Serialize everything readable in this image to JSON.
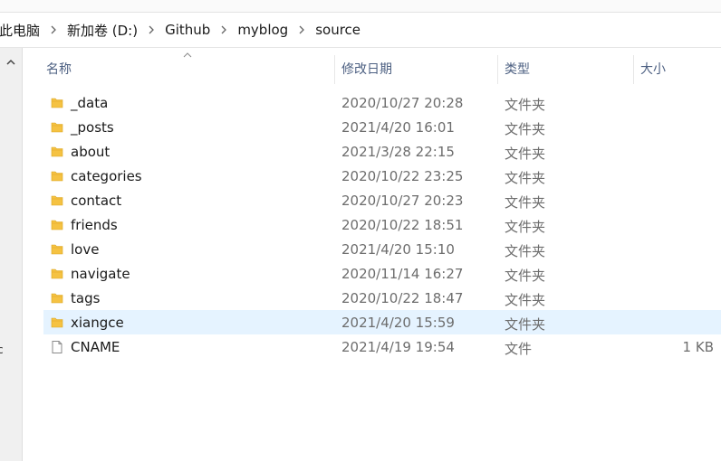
{
  "breadcrumb": {
    "items": [
      "此电脑",
      "新加卷 (D:)",
      "Github",
      "myblog",
      "source"
    ]
  },
  "columns": {
    "name": "名称",
    "date": "修改日期",
    "type": "类型",
    "size": "大小"
  },
  "nav_pane": {
    "fragment": "c"
  },
  "files": [
    {
      "name": "_data",
      "date": "2020/10/27 20:28",
      "type": "文件夹",
      "size": "",
      "icon": "folder-icon"
    },
    {
      "name": "_posts",
      "date": "2021/4/20 16:01",
      "type": "文件夹",
      "size": "",
      "icon": "folder-icon"
    },
    {
      "name": "about",
      "date": "2021/3/28 22:15",
      "type": "文件夹",
      "size": "",
      "icon": "folder-icon"
    },
    {
      "name": "categories",
      "date": "2020/10/22 23:25",
      "type": "文件夹",
      "size": "",
      "icon": "folder-icon"
    },
    {
      "name": "contact",
      "date": "2020/10/27 20:23",
      "type": "文件夹",
      "size": "",
      "icon": "folder-icon"
    },
    {
      "name": "friends",
      "date": "2020/10/22 18:51",
      "type": "文件夹",
      "size": "",
      "icon": "folder-icon"
    },
    {
      "name": "love",
      "date": "2021/4/20 15:10",
      "type": "文件夹",
      "size": "",
      "icon": "folder-icon"
    },
    {
      "name": "navigate",
      "date": "2020/11/14 16:27",
      "type": "文件夹",
      "size": "",
      "icon": "folder-icon"
    },
    {
      "name": "tags",
      "date": "2020/10/22 18:47",
      "type": "文件夹",
      "size": "",
      "icon": "folder-icon"
    },
    {
      "name": "xiangce",
      "date": "2021/4/20 15:59",
      "type": "文件夹",
      "size": "",
      "icon": "folder-icon",
      "selected": true
    },
    {
      "name": "CNAME",
      "date": "2021/4/19 19:54",
      "type": "文件",
      "size": "1 KB",
      "icon": "file-icon"
    }
  ],
  "colors": {
    "folder": "#f5c242",
    "selection": "#e5f3ff",
    "header_text": "#4d6082"
  }
}
